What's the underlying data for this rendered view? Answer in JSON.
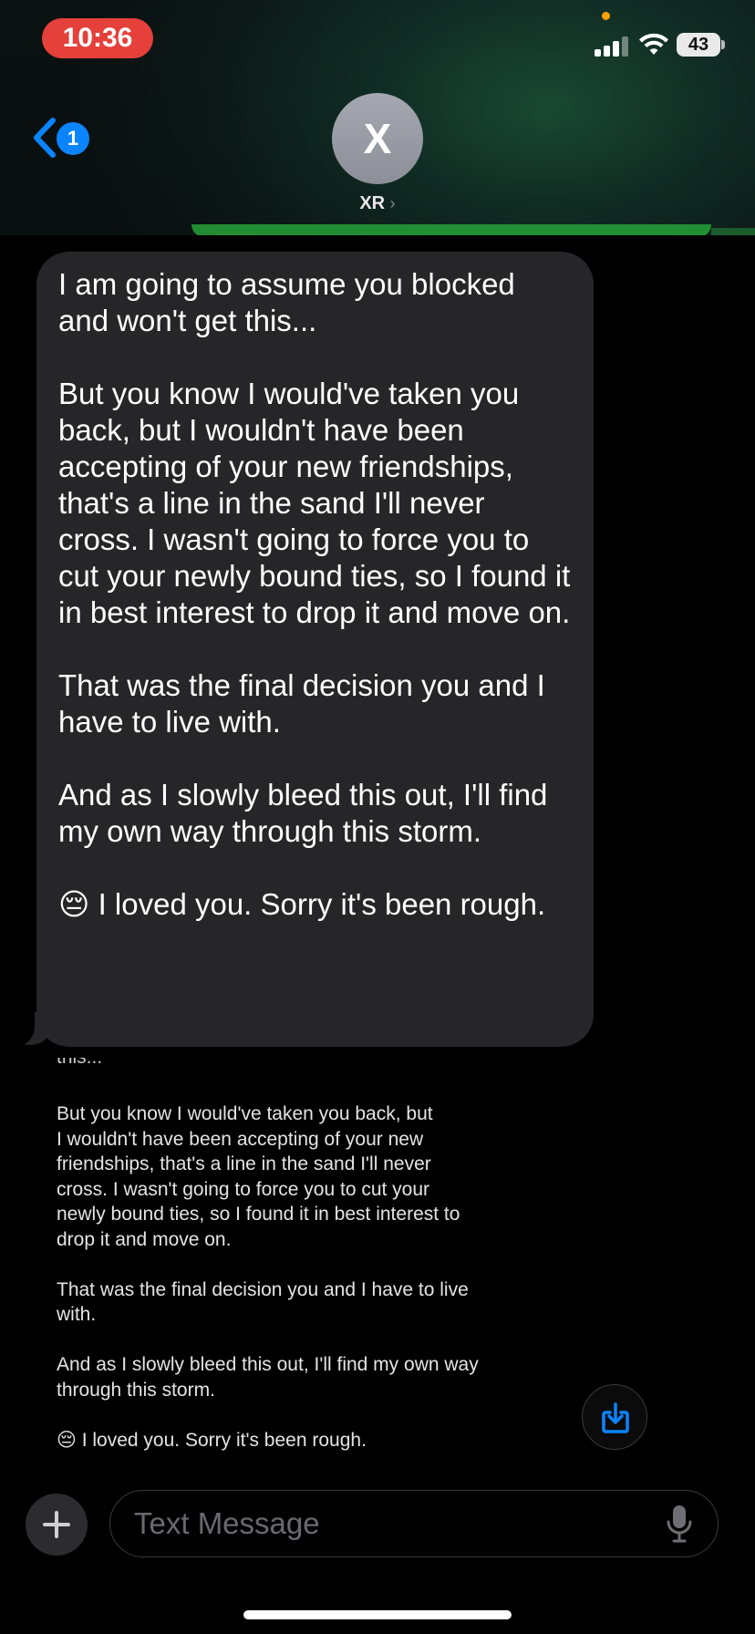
{
  "status_bar": {
    "time": "10:36",
    "battery": "43",
    "recording_dot_color": "#ff9f0a",
    "time_pill_color": "#e5403a"
  },
  "nav": {
    "unread_count": "1",
    "contact_initial": "X",
    "contact_name": "XR",
    "contact_chevron": "›",
    "accent_color": "#0a84ff"
  },
  "message": {
    "text": "I am going to assume you blocked and won't get this...\n\nBut you know I would've taken you back, but I wouldn't have been accepting of your new friendships, that's a line in the sand I'll never cross. I wasn't going to force you to cut your newly bound ties, so I found it in best interest to drop it and move on.\n\nThat was the final decision you and I have to live with.\n\nAnd as I slowly bleed this out, I'll find my own way through this storm.\n\n😔 I loved you. Sorry it's been rough."
  },
  "screenshot_attachment": {
    "cut_off_text": "this...",
    "text": "But you know I would've taken you back, but\nI wouldn't have been accepting of your new\nfriendships, that's a line in the sand I'll never\ncross. I wasn't going to force you to cut your\nnewly bound ties, so I found it in best interest to\ndrop it and move on.\n\nThat was the final decision you and I have to live\nwith.\n\nAnd as I slowly bleed this out, I'll find my own way\nthrough this storm.\n\n😔 I loved you. Sorry it's been rough."
  },
  "compose": {
    "placeholder": "Text Message",
    "value": ""
  },
  "icons": {
    "back": "chevron-left-icon",
    "save": "save-download-icon",
    "plus": "plus-icon",
    "mic": "microphone-icon"
  }
}
